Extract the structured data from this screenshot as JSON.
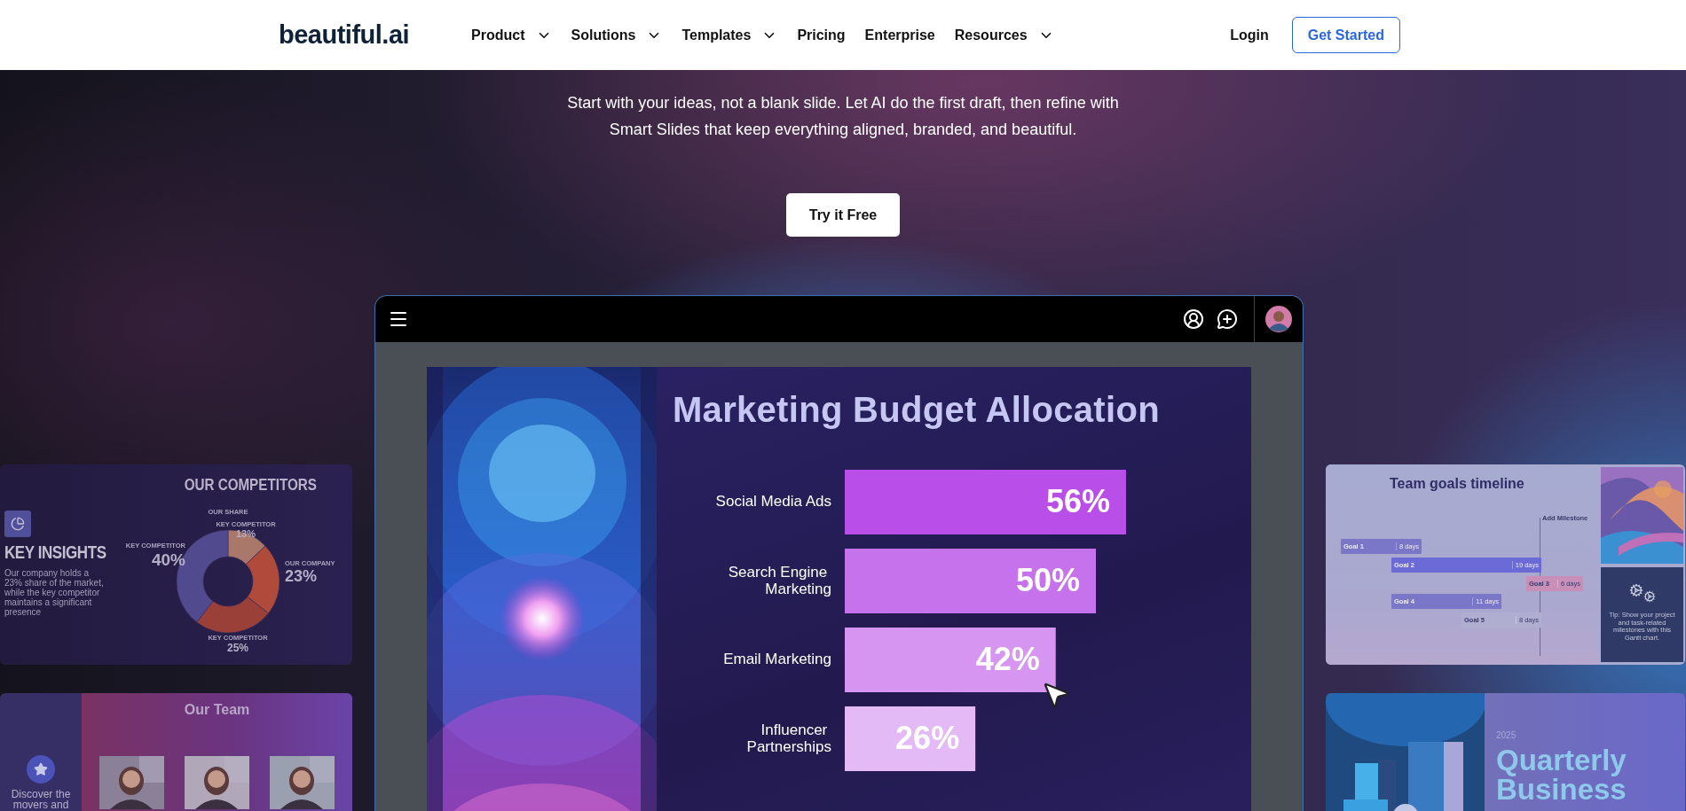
{
  "header": {
    "logo": "beautiful.ai",
    "nav": [
      {
        "label": "Product",
        "has_menu": true
      },
      {
        "label": "Solutions",
        "has_menu": true
      },
      {
        "label": "Templates",
        "has_menu": true
      },
      {
        "label": "Pricing",
        "has_menu": false
      },
      {
        "label": "Enterprise",
        "has_menu": false
      },
      {
        "label": "Resources",
        "has_menu": true
      }
    ],
    "login": "Login",
    "cta": "Get Started"
  },
  "hero": {
    "subtitle": "Start with your ideas, not a blank slide. Let AI do the first draft, then refine with Smart Slides that keep everything aligned, branded, and beautiful.",
    "button": "Try it Free"
  },
  "competitors_card": {
    "title": "OUR COMPETITORS",
    "heading": "KEY INSIGHTS",
    "text": "Our company holds a 23% share of the market, while the key competitor maintains a significant presence",
    "chart_data": {
      "type": "donut",
      "title": "OUR SHARE",
      "categories": [
        "KEY COMPETITOR",
        "OUR COMPANY",
        "KEY COMPETITOR",
        "KEY COMPETITOR"
      ],
      "values": [
        13,
        23,
        25,
        40
      ],
      "value_labels": [
        "13%",
        "23%",
        "25%",
        "40%"
      ]
    }
  },
  "team_card": {
    "title": "Our Team",
    "text": "Discover the movers and"
  },
  "app": {
    "slide": {
      "title": "Marketing Budget Allocation",
      "chart_data": {
        "type": "bar",
        "orientation": "horizontal",
        "categories": [
          "Social Media Ads",
          "Search Engine Marketing",
          "Email Marketing",
          "Influencer Partnerships"
        ],
        "values": [
          56,
          50,
          42,
          26
        ],
        "value_labels": [
          "56%",
          "50%",
          "42%",
          "26%"
        ]
      }
    }
  },
  "timeline_card": {
    "title": "Team goals timeline",
    "milestone": "Add Milestone",
    "goals": [
      {
        "label": "Goal 1",
        "duration": "8 days",
        "color": "#7a76c8"
      },
      {
        "label": "Goal 2",
        "duration": "19 days",
        "color": "#6c6ad6"
      },
      {
        "label": "Goal 3",
        "duration": "6 days",
        "color": "#c890b8"
      },
      {
        "label": "Goal 4",
        "duration": "11 days",
        "color": "#7a76c8"
      },
      {
        "label": "Goal 5",
        "duration": "8 days",
        "color": "#b0aed0"
      }
    ],
    "tip": "Tip: Show your project and task-related milestones with this Gantt chart."
  },
  "quarterly_card": {
    "year": "2025",
    "title_lines": [
      "Quarterly",
      "Business"
    ]
  }
}
